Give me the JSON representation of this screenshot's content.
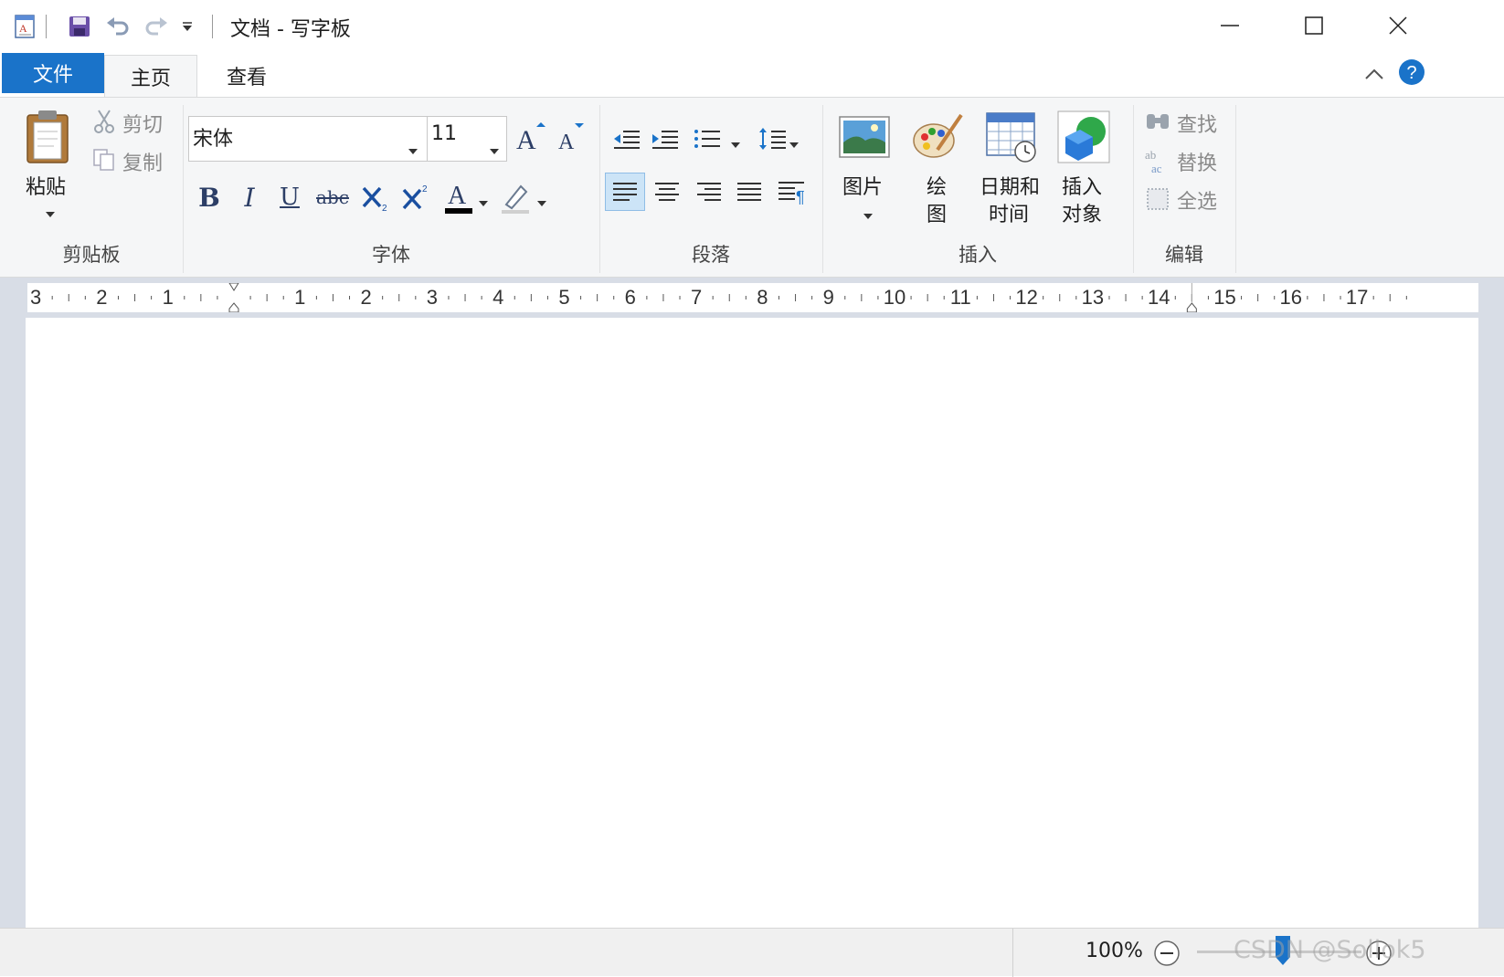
{
  "window": {
    "title": "文档 - 写字板",
    "app_icon": "wordpad-icon",
    "quick_access": [
      "save-icon",
      "undo-icon",
      "redo-icon",
      "customize-dropdown-icon"
    ],
    "controls": [
      "minimize-icon",
      "maximize-icon",
      "close-icon"
    ]
  },
  "tabs": {
    "file": "文件",
    "home": "主页",
    "view": "查看",
    "active": "主页"
  },
  "ribbon": {
    "clipboard": {
      "paste": "粘贴",
      "cut": "剪切",
      "copy": "复制",
      "label": "剪贴板"
    },
    "font": {
      "family": "宋体",
      "size": "11",
      "label": "字体",
      "buttons": [
        "grow-font-icon",
        "shrink-font-icon",
        "bold-icon",
        "italic-icon",
        "underline-icon",
        "strikethrough-icon",
        "subscript-icon",
        "superscript-icon",
        "text-color-icon",
        "highlight-icon"
      ]
    },
    "paragraph": {
      "label": "段落",
      "buttons": [
        "decrease-indent-icon",
        "increase-indent-icon",
        "bullets-icon",
        "line-spacing-icon",
        "align-left-icon",
        "align-center-icon",
        "align-right-icon",
        "justify-icon",
        "paragraph-icon"
      ]
    },
    "insert": {
      "picture": "图片",
      "paint_line1": "绘",
      "paint_line2": "图",
      "datetime_line1": "日期和",
      "datetime_line2": "时间",
      "object_line1": "插入",
      "object_line2": "对象",
      "label": "插入"
    },
    "editing": {
      "find": "查找",
      "replace": "替换",
      "select_all": "全选",
      "label": "编辑"
    }
  },
  "ruler": {
    "numbers": [
      "3",
      "2",
      "1",
      "1",
      "2",
      "3",
      "4",
      "5",
      "6",
      "7",
      "8",
      "9",
      "10",
      "11",
      "12",
      "13",
      "14",
      "15",
      "16",
      "17"
    ]
  },
  "status": {
    "zoom": "100%",
    "zoom_percent": 100,
    "watermark": "CSDN @Sollok5"
  },
  "colors": {
    "accent": "#1a73c9",
    "ribbon_bg": "#f5f6f7",
    "doc_bg": "#d8dde6",
    "text_color_bar": "#000000"
  }
}
